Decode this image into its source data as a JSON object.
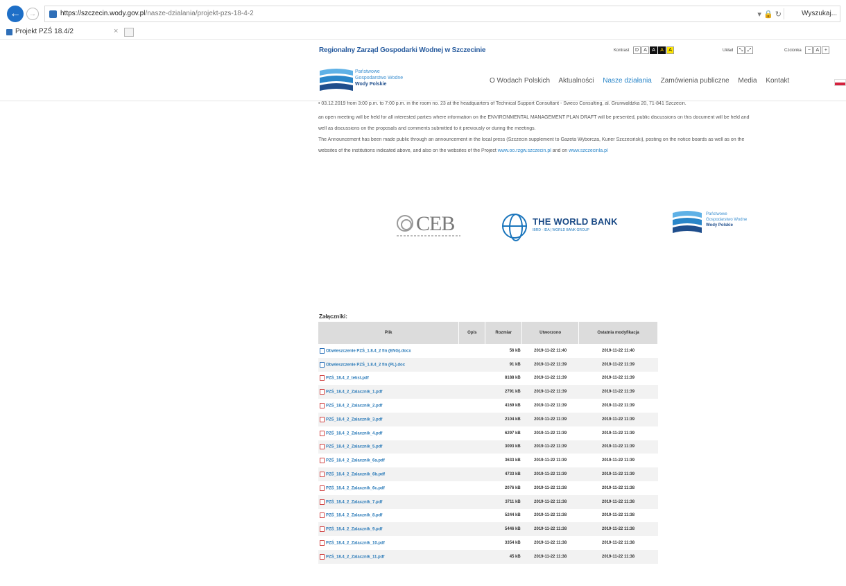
{
  "browser": {
    "url_host": "https://szczecin.wody.gov.pl",
    "url_path": "/nasze-dzialania/projekt-pzs-18-4-2",
    "search_placeholder": "Wyszukaj...",
    "tab_title": "Projekt PZŚ 18.4/2"
  },
  "header": {
    "site_name": "Regionalny Zarząd Gospodarki Wodnej w Szczecinie",
    "contrast_label": "Kontrast",
    "layout_label": "Układ",
    "font_label": "Czcionka",
    "logo_line1": "Państwowe",
    "logo_line2": "Gospodarstwo Wodne",
    "logo_line3": "Wody Polskie"
  },
  "nav": [
    "O Wodach Polskich",
    "Aktualności",
    "Nasze działania",
    "Zamówienia publiczne",
    "Media",
    "Kontakt"
  ],
  "content": {
    "line1": "• 03.12.2019 from 3:00 p.m. to 7:00 p.m. in the room no. 23 at the headquarters of Technical Support Consultant - Sweco Consulting, al. Grunwaldzka 20, 71-841 Szczecin.",
    "line2": "an open meeting will be held for all interested parties where information on the ENVIRONMENTAL MANAGEMENT PLAN DRAFT will be presented, public discussions on this document will be held and",
    "line3": "well as discussions on the proposals and comments submitted to it previously or during the meetings.",
    "line4": "The Announcement has been made public through an announcement in the local press (Szczecin supplement to Gazeta Wyborcza, Kurier Szczeciński), posting on the notice boards as well as on the",
    "line5a": "websites of the institutions indicated above, and also on the websites of the Project",
    "line5_link1": "www.oo.rzgw.szczecin.pl",
    "line5_and": " and on ",
    "line5_link2": "www.szczecinla.pl"
  },
  "sponsors": {
    "ceb": "CEB",
    "world_bank": "THE WORLD BANK",
    "world_bank_sub": "IBRD · IDA | WORLD BANK GROUP",
    "wp_line1": "Państwowe",
    "wp_line2": "Gospodarstwo Wodne",
    "wp_line3": "Wody Polskie"
  },
  "attachments": {
    "title": "Załączniki:",
    "columns": [
      "Plik",
      "Opis",
      "Rozmiar",
      "Utworzono",
      "Ostatnia modyfikacja"
    ],
    "rows": [
      {
        "file": "Obwieszczenie PZŚ_1.8.4_2 fin (ENG).docx",
        "type": "doc",
        "size": "56 kB",
        "created": "2019-11-22 11:40",
        "modified": "2019-11-22 11:40"
      },
      {
        "file": "Obwieszczenie PZŚ_1.8.4_2 fin (PL).doc",
        "type": "doc",
        "size": "91 kB",
        "created": "2019-11-22 11:39",
        "modified": "2019-11-22 11:39"
      },
      {
        "file": "PZŚ_18.4_2_tekst.pdf",
        "type": "pdf",
        "size": "8188 kB",
        "created": "2019-11-22 11:39",
        "modified": "2019-11-22 11:39"
      },
      {
        "file": "PZŚ_18.4_2_Zalacznik_1.pdf",
        "type": "pdf",
        "size": "2791 kB",
        "created": "2019-11-22 11:39",
        "modified": "2019-11-22 11:39"
      },
      {
        "file": "PZŚ_18.4_2_Zalacznik_2.pdf",
        "type": "pdf",
        "size": "4169 kB",
        "created": "2019-11-22 11:39",
        "modified": "2019-11-22 11:39"
      },
      {
        "file": "PZŚ_18.4_2_Zalacznik_3.pdf",
        "type": "pdf",
        "size": "2104 kB",
        "created": "2019-11-22 11:39",
        "modified": "2019-11-22 11:39"
      },
      {
        "file": "PZŚ_18.4_2_Zalacznik_4.pdf",
        "type": "pdf",
        "size": "6297 kB",
        "created": "2019-11-22 11:39",
        "modified": "2019-11-22 11:39"
      },
      {
        "file": "PZŚ_18.4_2_Zalacznik_5.pdf",
        "type": "pdf",
        "size": "3093 kB",
        "created": "2019-11-22 11:39",
        "modified": "2019-11-22 11:39"
      },
      {
        "file": "PZŚ_18.4_2_Zalacznik_6a.pdf",
        "type": "pdf",
        "size": "3633 kB",
        "created": "2019-11-22 11:39",
        "modified": "2019-11-22 11:39"
      },
      {
        "file": "PZŚ_18.4_2_Zalacznik_6b.pdf",
        "type": "pdf",
        "size": "4733 kB",
        "created": "2019-11-22 11:39",
        "modified": "2019-11-22 11:39"
      },
      {
        "file": "PZŚ_18.4_2_Zalacznik_6c.pdf",
        "type": "pdf",
        "size": "2076 kB",
        "created": "2019-11-22 11:38",
        "modified": "2019-11-22 11:38"
      },
      {
        "file": "PZŚ_18.4_2_Zalacznik_7.pdf",
        "type": "pdf",
        "size": "3711 kB",
        "created": "2019-11-22 11:38",
        "modified": "2019-11-22 11:38"
      },
      {
        "file": "PZŚ_18.4_2_Zalacznik_8.pdf",
        "type": "pdf",
        "size": "5244 kB",
        "created": "2019-11-22 11:38",
        "modified": "2019-11-22 11:38"
      },
      {
        "file": "PZŚ_18.4_2_Zalacznik_9.pdf",
        "type": "pdf",
        "size": "5446 kB",
        "created": "2019-11-22 11:38",
        "modified": "2019-11-22 11:38"
      },
      {
        "file": "PZŚ_18.4_2_Zalacznik_10.pdf",
        "type": "pdf",
        "size": "3354 kB",
        "created": "2019-11-22 11:38",
        "modified": "2019-11-22 11:38"
      },
      {
        "file": "PZŚ_18.4_2_Zalacznik_11.pdf",
        "type": "pdf",
        "size": "45 kB",
        "created": "2019-11-22 11:38",
        "modified": "2019-11-22 11:38"
      }
    ]
  },
  "colors": {
    "accent": "#2a86c9",
    "brand_dark": "#1f4e8c",
    "pdf_icon": "#d04545"
  }
}
